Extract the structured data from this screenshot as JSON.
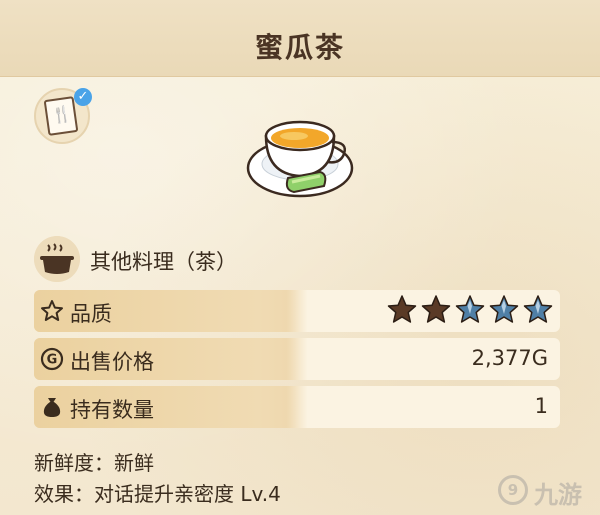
{
  "item": {
    "name": "蜜瓜茶",
    "category": "其他料理（茶）"
  },
  "stats": {
    "quality": {
      "label": "品质",
      "stars_filled": 2,
      "stars_total": 5
    },
    "price": {
      "label": "出售价格",
      "value": "2,377G"
    },
    "owned": {
      "label": "持有数量",
      "value": "1"
    }
  },
  "details": {
    "freshness": "新鲜度：新鲜",
    "effect": "效果：对话提升亲密度 Lv.4"
  },
  "icons": {
    "recipe": "recipe-card-icon",
    "check": "checkmark-icon",
    "pot": "cooking-pot-icon",
    "quality": "star-outline-icon",
    "price": "gold-coin-icon",
    "owned": "money-bag-icon"
  },
  "colors": {
    "star_filled": "#5a3a26",
    "star_empty": "#4f7fa6",
    "label_band": "#ebd19f",
    "text": "#3a2c1e"
  },
  "watermark": {
    "text": "九游"
  }
}
